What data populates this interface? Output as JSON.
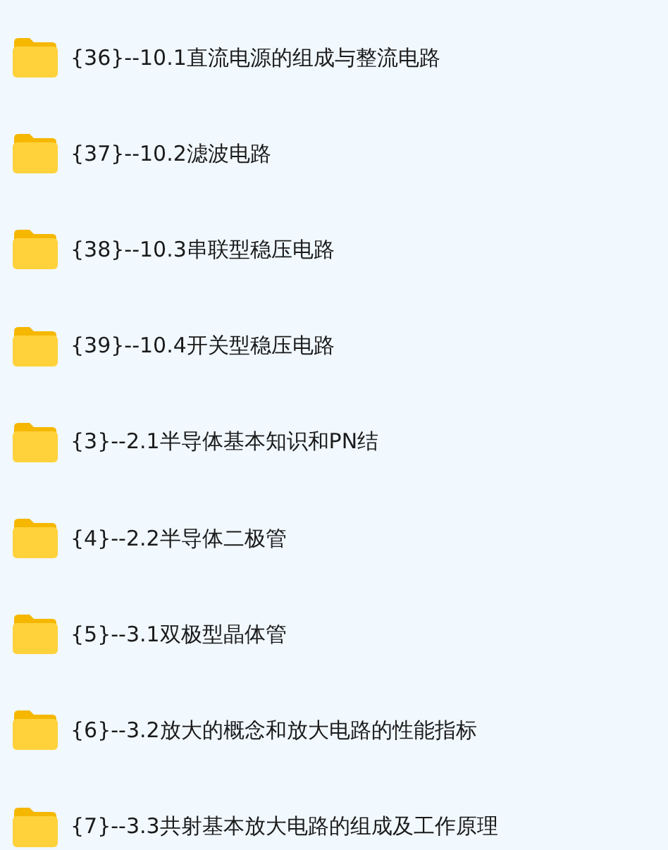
{
  "folders": [
    {
      "name": "{36}--10.1直流电源的组成与整流电路"
    },
    {
      "name": "{37}--10.2滤波电路"
    },
    {
      "name": "{38}--10.3串联型稳压电路"
    },
    {
      "name": "{39}--10.4开关型稳压电路"
    },
    {
      "name": "{3}--2.1半导体基本知识和PN结"
    },
    {
      "name": "{4}--2.2半导体二极管"
    },
    {
      "name": "{5}--3.1双极型晶体管"
    },
    {
      "name": "{6}--3.2放大的概念和放大电路的性能指标"
    },
    {
      "name": "{7}--3.3共射基本放大电路的组成及工作原理"
    }
  ]
}
